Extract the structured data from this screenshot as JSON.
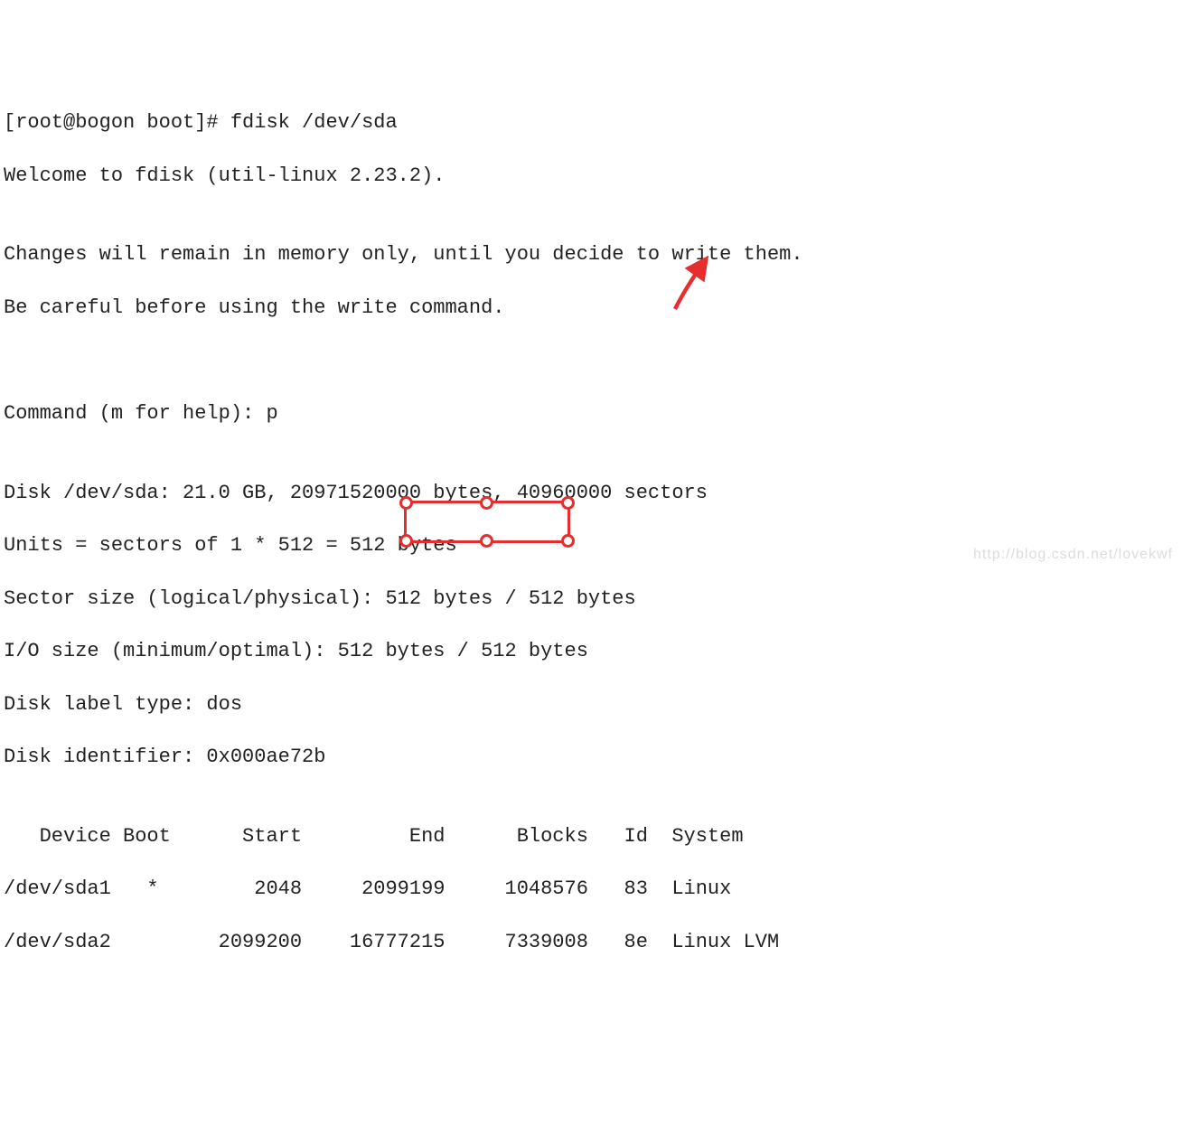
{
  "lines": {
    "l0": "[root@bogon boot]# fdisk /dev/sda",
    "l1": "Welcome to fdisk (util-linux 2.23.2).",
    "l2": "",
    "l3": "Changes will remain in memory only, until you decide to write them.",
    "l4": "Be careful before using the write command.",
    "l5": "",
    "l6": "",
    "l7": "Command (m for help): p",
    "l8": "",
    "l9": "Disk /dev/sda: 21.0 GB, 20971520000 bytes, 40960000 sectors",
    "l10": "Units = sectors of 1 * 512 = 512 bytes",
    "l11": "Sector size (logical/physical): 512 bytes / 512 bytes",
    "l12": "I/O size (minimum/optimal): 512 bytes / 512 bytes",
    "l13": "Disk label type: dos",
    "l14": "Disk identifier: 0x000ae72b",
    "l15": "",
    "l16": "   Device Boot      Start         End      Blocks   Id  System",
    "l17": "/dev/sda1   *        2048     2099199     1048576   83  Linux",
    "l18": "/dev/sda2         2099200    16777215     7339008   8e  Linux LVM"
  },
  "watermark": "http://blog.csdn.net/lovekwf",
  "annotations": {
    "arrow_color": "#e62e2e",
    "box_color": "#e62e2e"
  }
}
